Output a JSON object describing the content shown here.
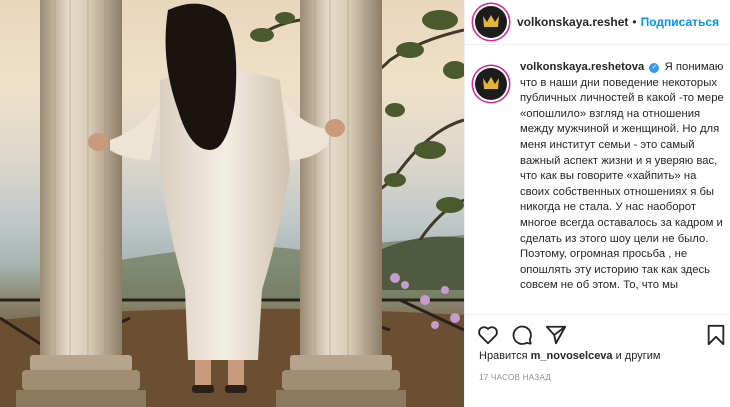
{
  "post": {
    "author": {
      "username_header": "volkonskaya.reshet",
      "username_caption": "volkonskaya.reshetova",
      "verified": true,
      "avatar_icon": "crown-icon"
    },
    "follow_label": "Подписаться",
    "separator": "•",
    "caption_text": "Я понимаю что в наши дни поведение некоторых публичных личностей в какой -то мере «опошлило» взгляд на отношения между мужчиной и женщиной. Но для меня институт семьи - это самый важный аспект жизни и я уверяю вас, что как вы говорите «хайпить» на своих собственных отношениях я бы никогда не стала. У нас наоборот многое всегда оставалось за кадром и сделать из этого шоу цели не было. Поэтому, огромная просьба , не опошлять эту историю так как здесь совсем не об этом. То, что мы",
    "likes": {
      "prefix": "Нравится",
      "user": "m_novoselceva",
      "suffix": "и другим"
    },
    "time": "17 ЧАСОВ НАЗАД"
  },
  "icons": {
    "like": "heart-icon",
    "comment": "comment-icon",
    "share": "share-icon",
    "save": "bookmark-icon"
  },
  "colors": {
    "accent": "#0095f6",
    "verified": "#3897f0",
    "muted": "#8e8e8e",
    "text": "#262626"
  }
}
